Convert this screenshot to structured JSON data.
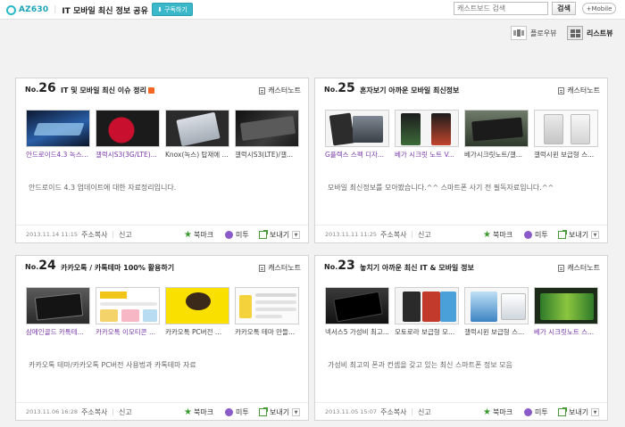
{
  "header": {
    "brand_id": "AZ630",
    "site_title": "IT 모바일 최신 정보 공유",
    "subscribe_label": "구독하기",
    "search_placeholder": "캐스트보드 검색",
    "search_button": "검색",
    "mobile_button": "+Mobile"
  },
  "views": {
    "flow_label": "플로우뷰",
    "list_label": "리스트뷰"
  },
  "cards": [
    {
      "no_prefix": "No.",
      "number": "26",
      "title": "IT 및 모바일 최신 이슈 정리",
      "note_label": "캐스터노트",
      "thumbs": [
        {
          "caption": "안드로이드4.3 녹스(..."
        },
        {
          "caption": "갤럭시S3(3G/LTE)..."
        },
        {
          "caption": "Knox(녹스) 탑재에 ..."
        },
        {
          "caption": "갤럭시S3(LTE)/갤..."
        }
      ],
      "description": "안드로이드 4.3 업데이트에 대한 자료정리입니다.",
      "date": "2013.11.14 11:15",
      "copy_label": "주소복사",
      "report_label": "신고",
      "bookmark_label": "북마크",
      "mitu_label": "미투",
      "send_label": "보내기"
    },
    {
      "no_prefix": "No.",
      "number": "25",
      "title": "혼자보기 아까운 모바일 최신정보",
      "note_label": "캐스터노트",
      "thumbs": [
        {
          "caption": "G플렉스 스펙 디자..."
        },
        {
          "caption": "베가 시크릿 노트 V..."
        },
        {
          "caption": "베가시크릿노트/갤..."
        },
        {
          "caption": "갤럭시윈 보급형 스..."
        }
      ],
      "description": "모바일 최신정보를 모아봤습니다.^^ 스마트폰 사기 전 필독자료입니다.^^",
      "date": "2013.11.11 11:25",
      "copy_label": "주소복사",
      "report_label": "신고",
      "bookmark_label": "북마크",
      "mitu_label": "미투",
      "send_label": "보내기"
    },
    {
      "no_prefix": "No.",
      "number": "24",
      "title": "카카오톡 / 카톡테마 100% 활용하기",
      "note_label": "캐스터노트",
      "thumbs": [
        {
          "caption": "삼메인골드 카톡테..."
        },
        {
          "caption": "카카오톡 이모티콘 ..."
        },
        {
          "caption": "카카오톡 PC버전 ..."
        },
        {
          "caption": "카카오톡 테마 만들..."
        }
      ],
      "description": "카카오톡 테마/카카오톡 PC버전 사용법과 카톡테마 자료",
      "date": "2013.11.06 16:28",
      "copy_label": "주소복사",
      "report_label": "신고",
      "bookmark_label": "북마크",
      "mitu_label": "미투",
      "send_label": "보내기"
    },
    {
      "no_prefix": "No.",
      "number": "23",
      "title": "놓치기 아까운 최신 IT & 모바일 정보",
      "note_label": "캐스터노트",
      "thumbs": [
        {
          "caption": "넥서스5 가성비 최고..."
        },
        {
          "caption": "모토로라 보급형 모..."
        },
        {
          "caption": "갤럭시윈 보급형 스..."
        },
        {
          "caption": "베가 시크릿노트 스..."
        }
      ],
      "description": "가성비 최고의 폰과 컨셉을 갖고 있는 최신 스마트폰 정보 모음",
      "date": "2013.11.05 15:07",
      "copy_label": "주소복사",
      "report_label": "신고",
      "bookmark_label": "북마크",
      "mitu_label": "미투",
      "send_label": "보내기"
    }
  ]
}
